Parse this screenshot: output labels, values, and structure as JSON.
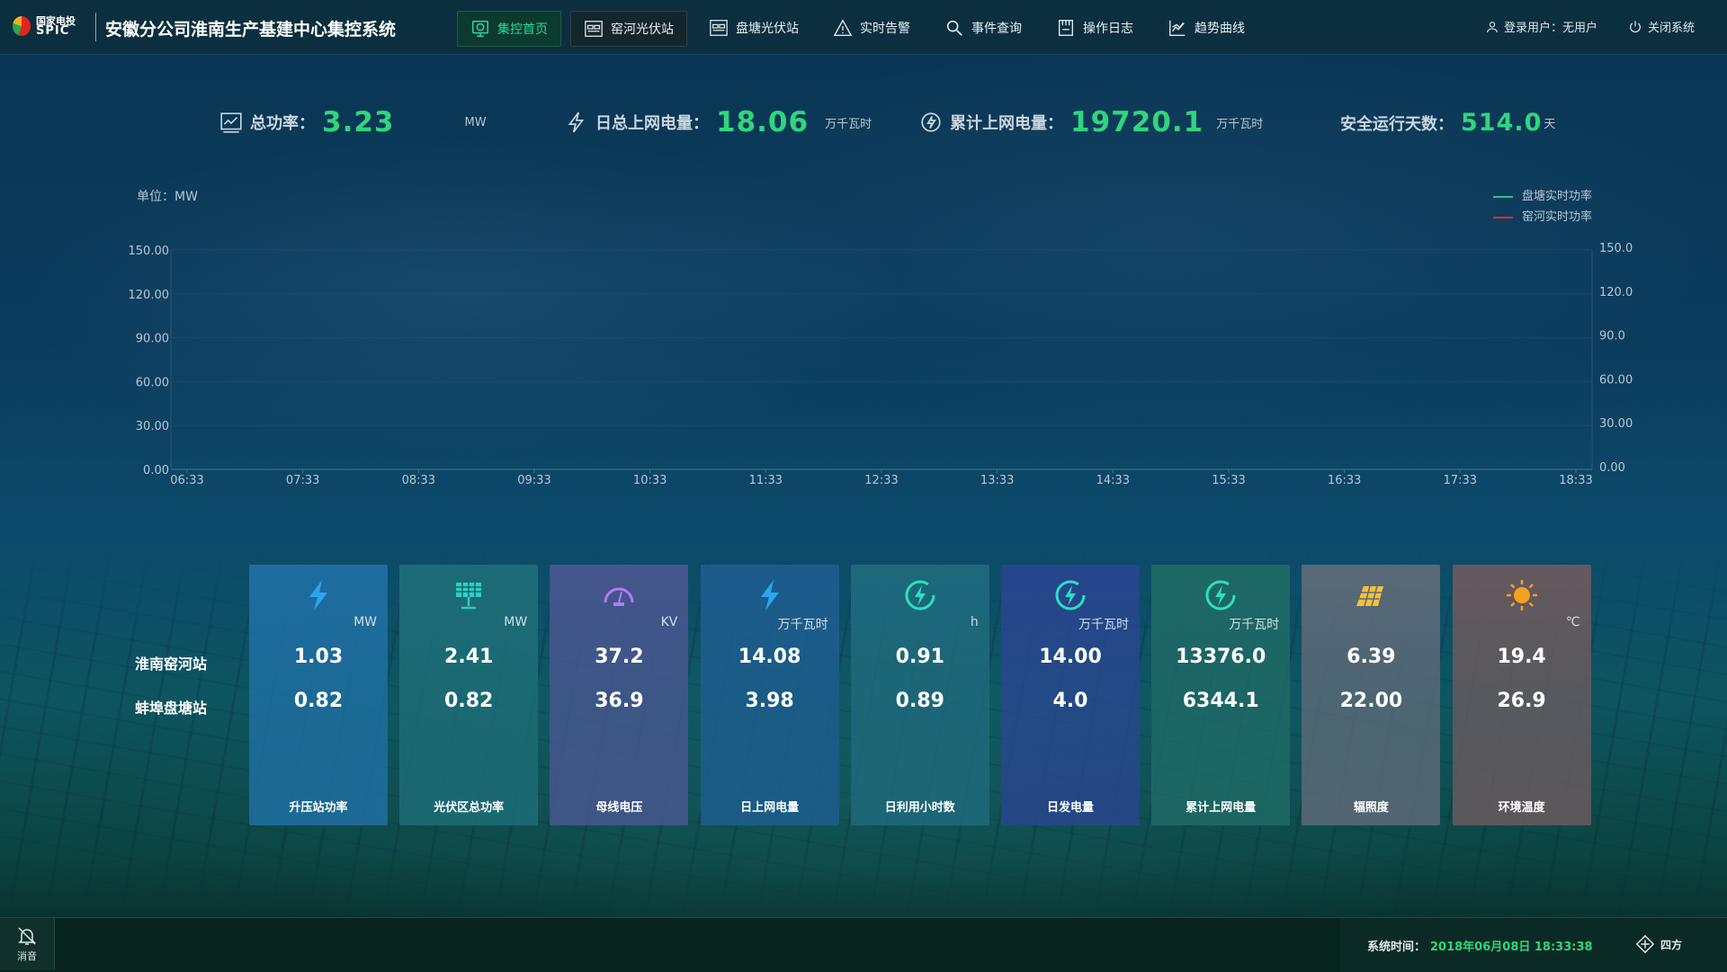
{
  "header": {
    "logo_cn": "国家电投",
    "logo_en": "SPIC",
    "title": "安徽分公司淮南生产基建中心集控系统",
    "nav": [
      {
        "label": "集控首页",
        "icon": "monitor-icon"
      },
      {
        "label": "窑河光伏站",
        "icon": "station-icon"
      },
      {
        "label": "盘塘光伏站",
        "icon": "station-icon"
      },
      {
        "label": "实时告警",
        "icon": "warning-icon"
      },
      {
        "label": "事件查询",
        "icon": "search-icon"
      },
      {
        "label": "操作日志",
        "icon": "log-icon"
      },
      {
        "label": "趋势曲线",
        "icon": "trend-icon"
      }
    ],
    "user": "登录用户：无用户",
    "logout": "关闭系统"
  },
  "kpis": {
    "total_power": {
      "label": "总功率：",
      "value": "3.23",
      "unit": "MW"
    },
    "daily_grid": {
      "label": "日总上网电量：",
      "value": "18.06",
      "unit": "万千瓦时"
    },
    "cumulative_grid": {
      "label": "累计上网电量：",
      "value": "19720.1",
      "unit": "万千瓦时"
    },
    "safe_days": {
      "label": "安全运行天数：",
      "value": "514.0",
      "unit": "天"
    }
  },
  "chart_data": {
    "type": "line",
    "unit_label": "单位：MW",
    "x": [
      "06:33",
      "07:33",
      "08:33",
      "09:33",
      "10:33",
      "11:33",
      "12:33",
      "13:33",
      "14:33",
      "15:33",
      "16:33",
      "17:33",
      "18:33"
    ],
    "y_left_ticks": [
      "0.00",
      "30.00",
      "60.00",
      "90.00",
      "120.00",
      "150.00"
    ],
    "y_right_ticks": [
      "0.00",
      "30.00",
      "60.00",
      "90.0",
      "120.0",
      "150.0"
    ],
    "ylim": [
      0,
      150
    ],
    "grid": true,
    "legend_position": "top-right",
    "series": [
      {
        "name": "盘塘实时功率",
        "color": "#2fbf8f",
        "values": []
      },
      {
        "name": "窑河实时功率",
        "color": "#e0302a",
        "values": []
      }
    ]
  },
  "stations": [
    "淮南窑河站",
    "蚌埠盘塘站"
  ],
  "cards": [
    {
      "name": "升压站功率",
      "unit": "MW",
      "v1": "1.03",
      "v2": "0.82",
      "icon": "lightning-icon",
      "bg": "#1f6fa3",
      "accent": "#29a6f0"
    },
    {
      "name": "光伏区总功率",
      "unit": "MW",
      "v1": "2.41",
      "v2": "0.82",
      "icon": "solar-panel-icon",
      "bg": "#1d6e78",
      "accent": "#2ad0c8"
    },
    {
      "name": "母线电压",
      "unit": "KV",
      "v1": "37.2",
      "v2": "36.9",
      "icon": "gauge-icon",
      "bg": "#48568f",
      "accent": "#b07cf0"
    },
    {
      "name": "日上网电量",
      "unit": "万千瓦时",
      "v1": "14.08",
      "v2": "3.98",
      "icon": "lightning-icon",
      "bg": "#1d5d8f",
      "accent": "#29a6f0"
    },
    {
      "name": "日利用小时数",
      "unit": "h",
      "v1": "0.91",
      "v2": "0.89",
      "icon": "energy-circle-icon",
      "bg": "#1e6a7c",
      "accent": "#2ae0c0"
    },
    {
      "name": "日发电量",
      "unit": "万千瓦时",
      "v1": "14.00",
      "v2": "4.0",
      "icon": "energy-circle-icon",
      "bg": "#28468e",
      "accent": "#2ae0c0"
    },
    {
      "name": "累计上网电量",
      "unit": "万千瓦时",
      "v1": "13376.0",
      "v2": "6344.1",
      "icon": "energy-circle-icon",
      "bg": "#1f6a66",
      "accent": "#2ae0c0"
    },
    {
      "name": "辐照度",
      "unit": "",
      "v1": "6.39",
      "v2": "22.00",
      "icon": "panel-sun-icon",
      "bg": "#5d6a78",
      "accent": "#f5c13a"
    },
    {
      "name": "环境温度",
      "unit": "℃",
      "v1": "19.4",
      "v2": "26.9",
      "icon": "sun-icon",
      "bg": "#6a5a5e",
      "accent": "#f5a020"
    }
  ],
  "footer": {
    "mute": "消音",
    "sys_time_label": "系统时间：",
    "sys_time_value": "2018年06月08日 18:33:38",
    "brand": "四方"
  }
}
